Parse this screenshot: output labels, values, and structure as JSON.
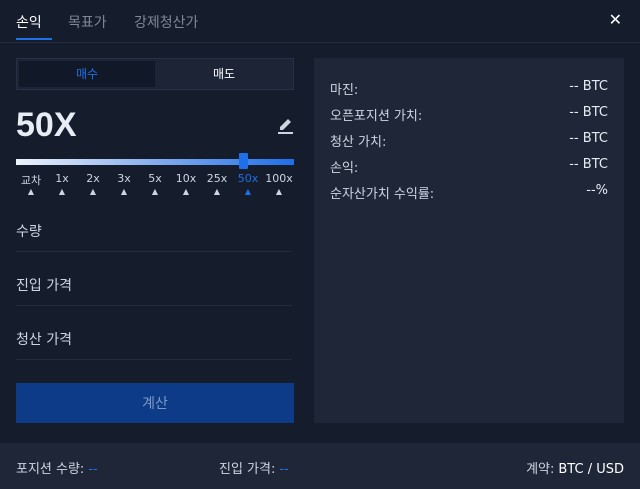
{
  "tabs": [
    {
      "label": "손익"
    },
    {
      "label": "목표가"
    },
    {
      "label": "강제청산가"
    }
  ],
  "side": {
    "buy": "매수",
    "sell": "매도"
  },
  "leverage": {
    "value": "50X",
    "slider_fraction": 0.82,
    "ticks": [
      "교차",
      "1x",
      "2x",
      "3x",
      "5x",
      "10x",
      "25x",
      "50x",
      "100x"
    ],
    "active_tick": "50x"
  },
  "fields": {
    "quantity": "수량",
    "entry_price": "진입 가격",
    "exit_price": "청산 가격"
  },
  "calculate_button": "계산",
  "results": [
    {
      "label": "마진:",
      "value": "-- BTC"
    },
    {
      "label": "오픈포지션 가치:",
      "value": "-- BTC"
    },
    {
      "label": "청산 가치:",
      "value": "-- BTC"
    },
    {
      "label": "손익:",
      "value": "-- BTC"
    },
    {
      "label": "순자산가치 수익률:",
      "value": "--%"
    }
  ],
  "footer": {
    "position_qty_label": "포지션 수량:",
    "position_qty_value": "--",
    "entry_price_label": "진입 가격:",
    "entry_price_value": "--",
    "contract_label": "계약:",
    "contract_value": "BTC / USD"
  },
  "colors": {
    "accent": "#1f6fe8",
    "background": "#151c2c",
    "panel": "#1e2638",
    "button": "#0d3b87"
  },
  "icons": {
    "close": "close-icon",
    "edit": "pencil-icon",
    "tick_arrow": "triangle-up-icon"
  }
}
